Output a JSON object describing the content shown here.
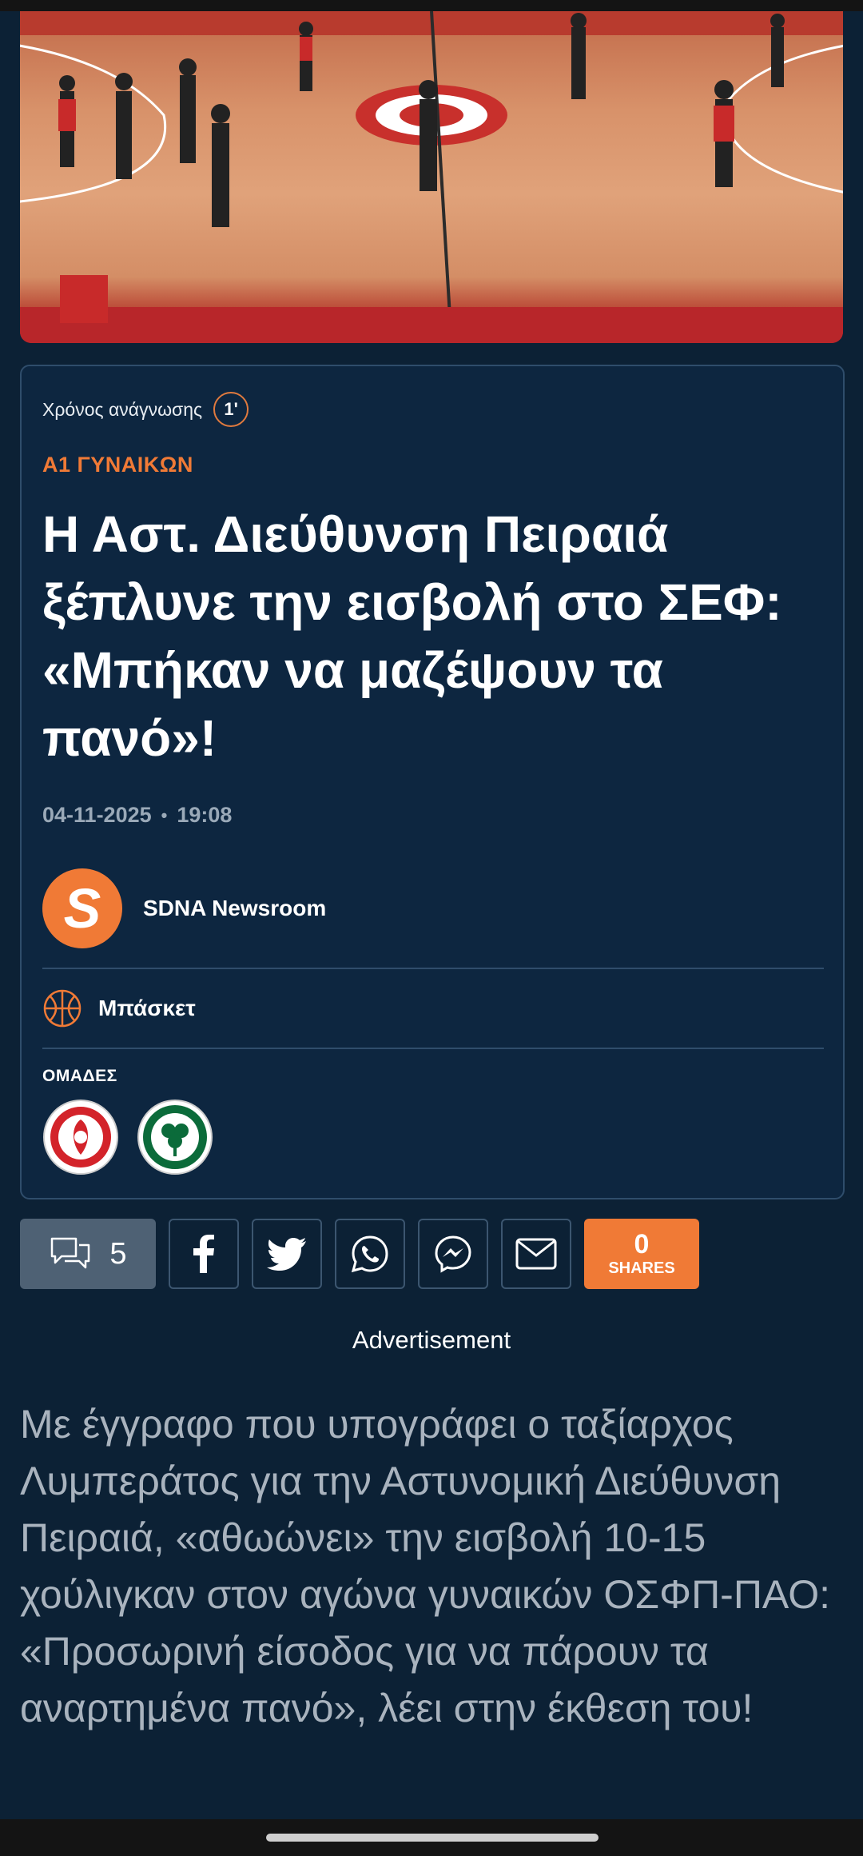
{
  "hero": {
    "image_description_icon": "basketball-court-photo-icon"
  },
  "article": {
    "read_time_label": "Χρόνος ανάγνωσης",
    "read_time_value": "1'",
    "category": "Α1 ΓΥΝΑΙΚΩΝ",
    "title": "Η Αστ. Διεύθυνση Πειραιά ξέπλυνε την εισβολή στο ΣΕΦ: «Μπήκαν να μαζέψουν τα πανό»!",
    "date": "04-11-2025",
    "separator": "•",
    "time": "19:08",
    "author": {
      "initial": "S",
      "name": "SDNA Newsroom"
    },
    "sport": {
      "icon": "basketball-icon",
      "label": "Μπάσκετ"
    },
    "teams_label": "ΟΜΑΔΕΣ",
    "teams": [
      {
        "name": "Olympiacos",
        "icon": "olympiacos-logo"
      },
      {
        "name": "Panathinaikos",
        "icon": "panathinaikos-logo"
      }
    ]
  },
  "share": {
    "comments_count": "5",
    "shares_count": "0",
    "shares_label": "SHARES",
    "buttons": [
      "facebook-icon",
      "twitter-icon",
      "whatsapp-icon",
      "messenger-icon",
      "mail-icon"
    ]
  },
  "ad_label": "Advertisement",
  "body_text": "Με έγγραφο που υπογράφει ο ταξίαρχος Λυμπεράτος για την Αστυνομική Διεύθυνση Πειραιά, «αθωώνει» την εισβολή 10-15 χούλιγκαν στον αγώνα γυναικών ΟΣΦΠ-ΠΑΟ: «Προσωρινή είσοδος για να πάρουν τα αναρτημένα πανό», λέει στην έκθεση του!",
  "colors": {
    "accent": "#f07a36",
    "background": "#0c2135",
    "card": "#0d2640",
    "border": "#2f4d6b"
  }
}
